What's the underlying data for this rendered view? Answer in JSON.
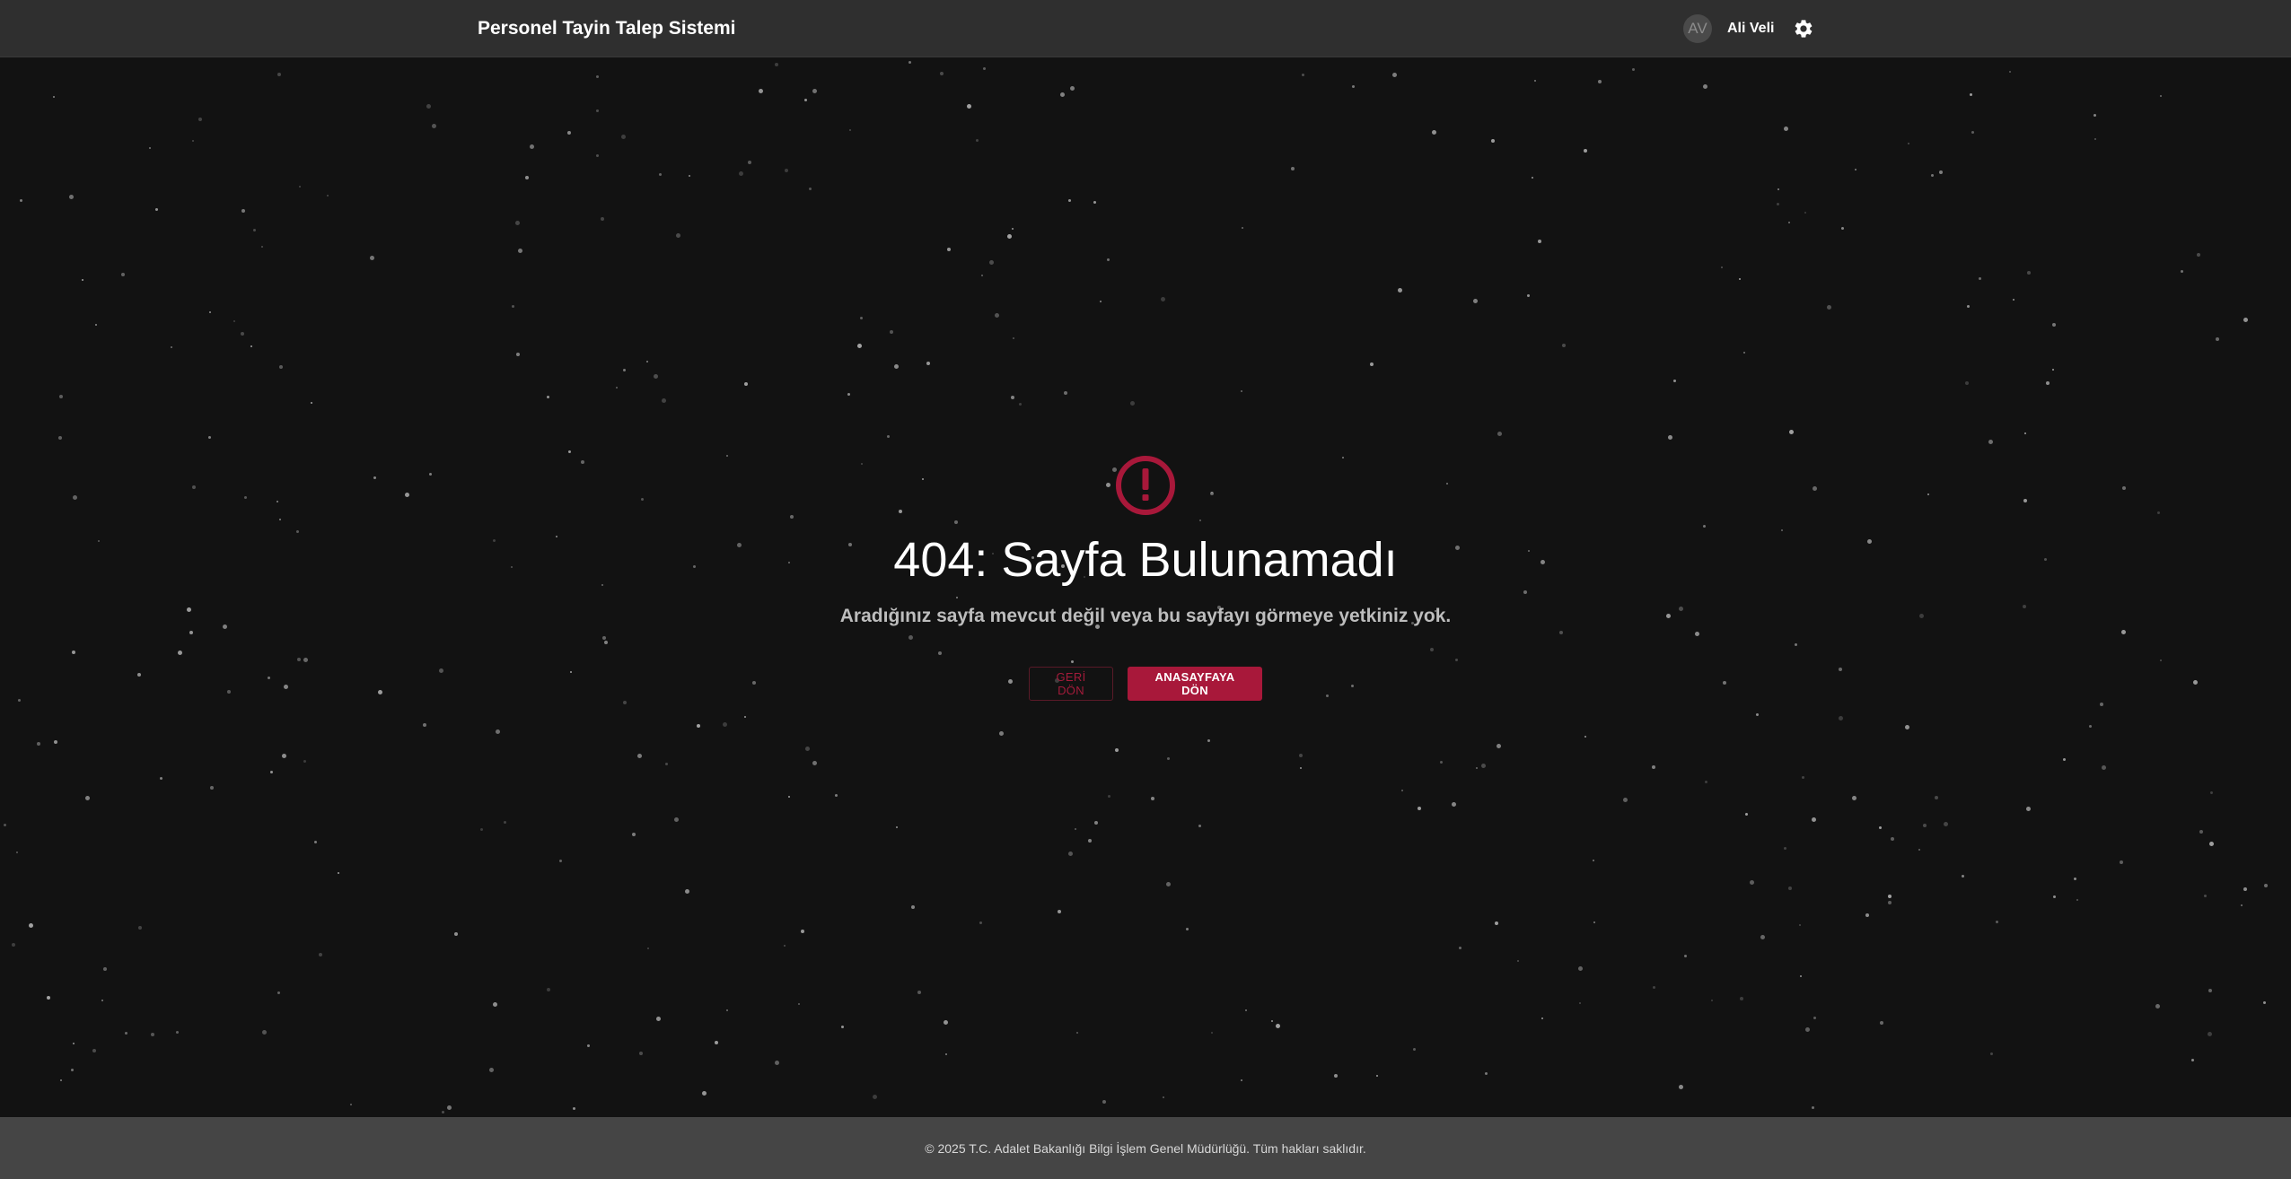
{
  "header": {
    "title": "Personel Tayin Talep Sistemi",
    "user": {
      "initials": "AV",
      "name": "Ali Veli"
    },
    "settings_icon": "gear-icon"
  },
  "error": {
    "icon": "error-circle-icon",
    "title": "404: Sayfa Bulunamadı",
    "message": "Aradığınız sayfa mevcut değil veya bu sayfayı görmeye yetkiniz yok."
  },
  "actions": {
    "back_label": "GERİ DÖN",
    "home_label": "ANASAYFAYA DÖN"
  },
  "footer": {
    "text": "© 2025 T.C. Adalet Bakanlığı Bilgi İşlem Genel Müdürlüğü. Tüm hakları saklıdır."
  },
  "colors": {
    "accent": "#a8183a",
    "header_bg": "#2f2f2f",
    "page_bg": "#121212",
    "footer_bg": "#454545"
  }
}
